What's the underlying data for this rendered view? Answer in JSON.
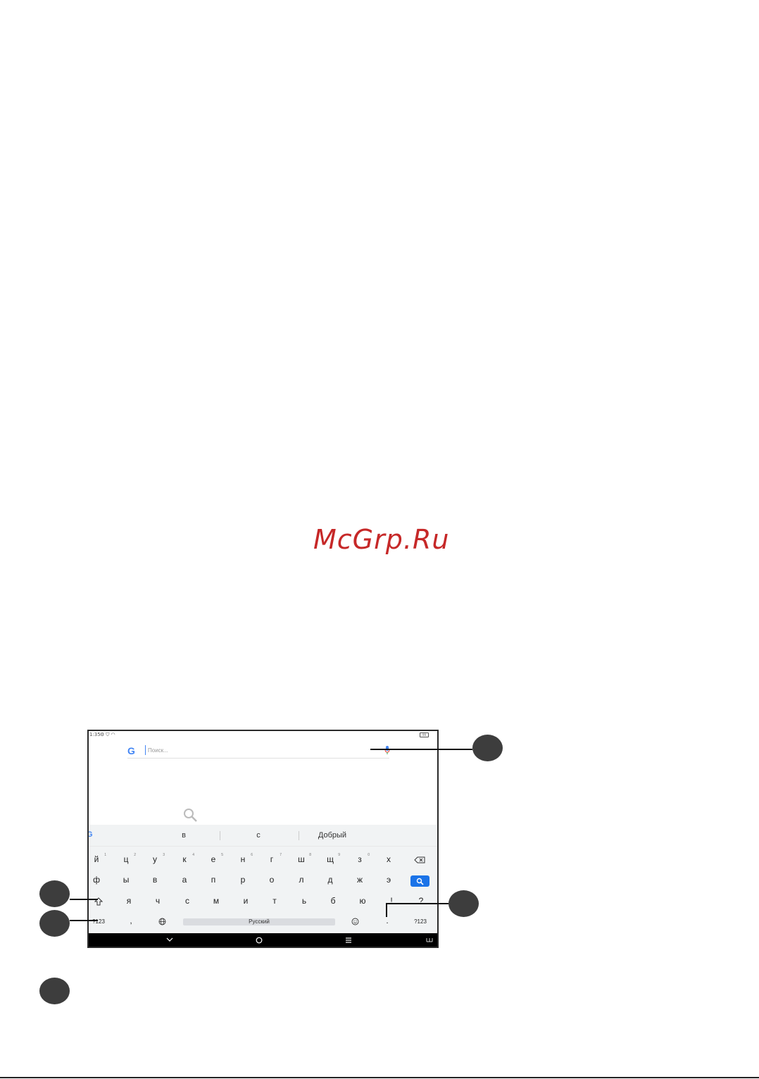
{
  "watermark": "McGrp.Ru",
  "device": {
    "status": {
      "time": "1:35",
      "battery": "99"
    },
    "search": {
      "logo": "G",
      "placeholder": "Поиск..."
    },
    "suggestions": {
      "logo": "G",
      "items": [
        "в",
        "с",
        "Добрый"
      ]
    },
    "keyboard": {
      "row1": [
        {
          "k": "й",
          "n": "1"
        },
        {
          "k": "ц",
          "n": "2"
        },
        {
          "k": "у",
          "n": "3"
        },
        {
          "k": "к",
          "n": "4"
        },
        {
          "k": "е",
          "n": "5"
        },
        {
          "k": "н",
          "n": "6"
        },
        {
          "k": "г",
          "n": "7"
        },
        {
          "k": "ш",
          "n": "8"
        },
        {
          "k": "щ",
          "n": "9"
        },
        {
          "k": "з",
          "n": "0"
        },
        {
          "k": "х",
          "n": ""
        }
      ],
      "row2": [
        "ф",
        "ы",
        "в",
        "а",
        "п",
        "р",
        "о",
        "л",
        "д",
        "ж",
        "э"
      ],
      "row3": [
        "я",
        "ч",
        "с",
        "м",
        "и",
        "т",
        "ь",
        "б",
        "ю",
        "!",
        "?"
      ],
      "row4": {
        "sym_left": "?123",
        "comma": ",",
        "space": "Русский",
        "period": ".",
        "sym_right": "?123"
      }
    }
  }
}
